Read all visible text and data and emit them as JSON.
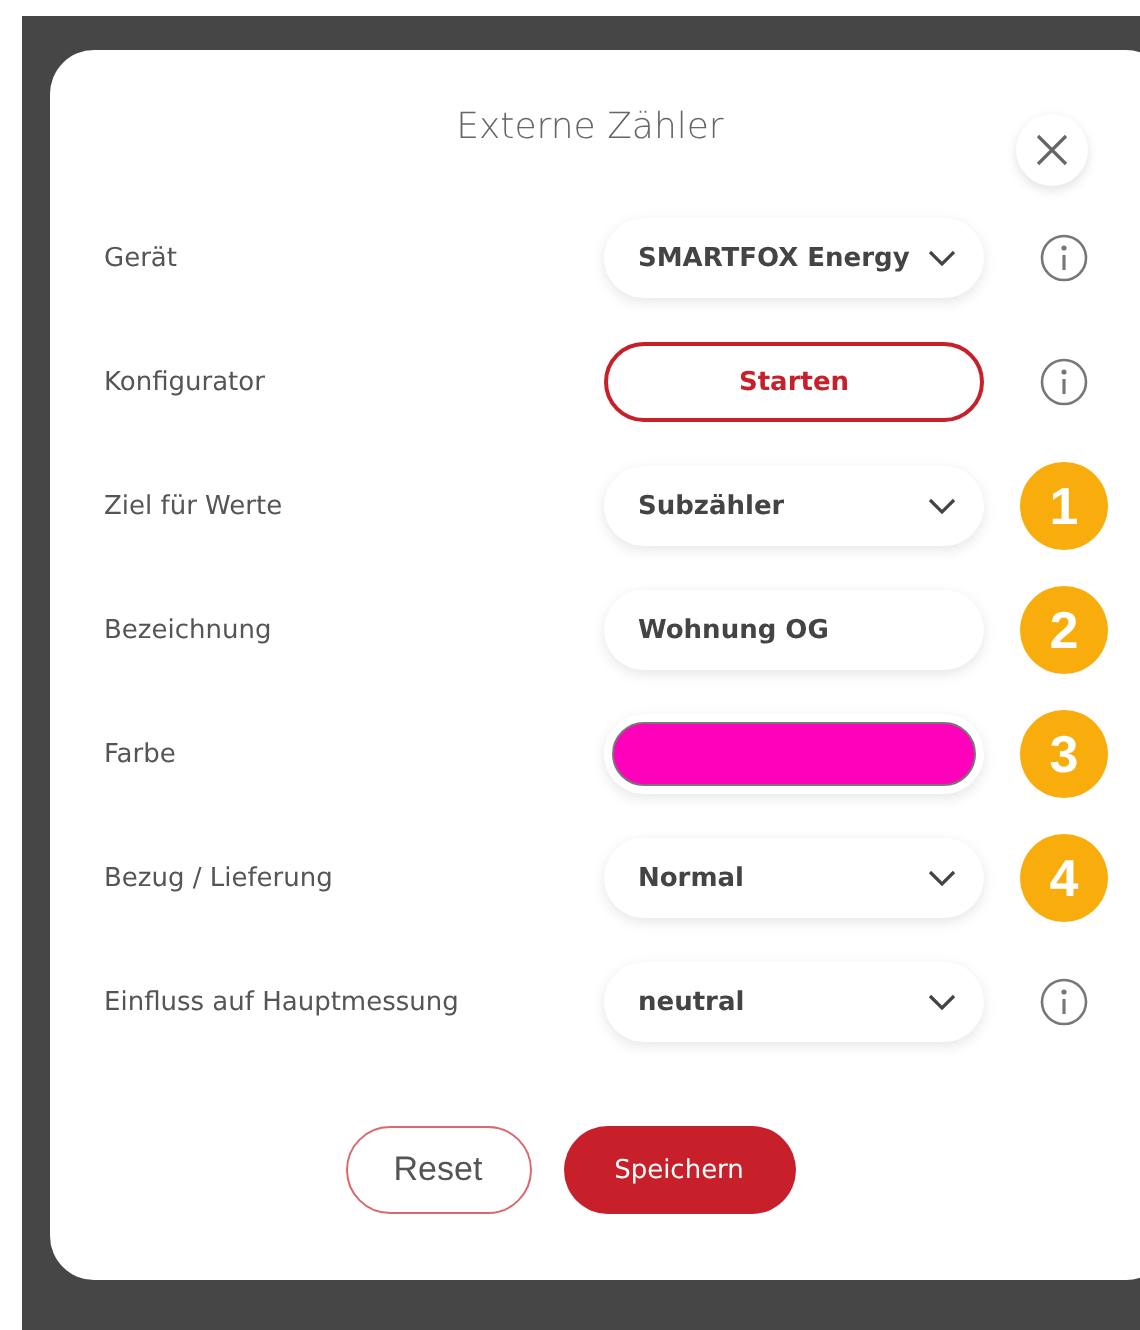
{
  "dialog": {
    "title": "Externe Zähler"
  },
  "rows": [
    {
      "label": "Gerät",
      "kind": "select",
      "value": "SMARTFOX Energy",
      "side": {
        "kind": "info"
      }
    },
    {
      "label": "Konfigurator",
      "kind": "button",
      "value": "Starten",
      "side": {
        "kind": "info"
      }
    },
    {
      "label": "Ziel für Werte",
      "kind": "select",
      "value": "Subzähler",
      "side": {
        "kind": "badge",
        "text": "1"
      }
    },
    {
      "label": "Bezeichnung",
      "kind": "text",
      "value": "Wohnung OG",
      "side": {
        "kind": "badge",
        "text": "2"
      }
    },
    {
      "label": "Farbe",
      "kind": "color",
      "color": "#ff00bb",
      "side": {
        "kind": "badge",
        "text": "3"
      }
    },
    {
      "label": "Bezug / Lieferung",
      "kind": "select",
      "value": "Normal",
      "side": {
        "kind": "badge",
        "text": "4"
      }
    },
    {
      "label": "Einfluss auf Hauptmessung",
      "kind": "select",
      "value": "neutral",
      "side": {
        "kind": "info"
      }
    }
  ],
  "buttons": [
    {
      "label": "Reset",
      "kind": "secondary"
    },
    {
      "label": "Speichern",
      "kind": "primary"
    }
  ]
}
